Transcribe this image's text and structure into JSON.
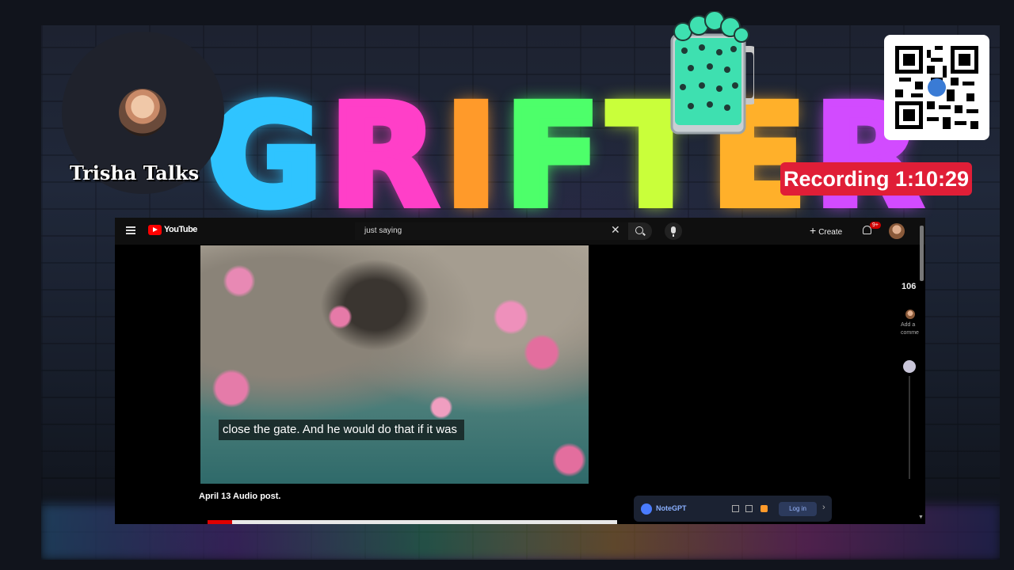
{
  "overlay": {
    "streamer_name": "Trisha Talks",
    "recording_label": "Recording 1:10:29"
  },
  "neon_sign": {
    "text": "GRIFTER"
  },
  "youtube": {
    "wordmark": "YouTube",
    "search_value": "just saying",
    "create_label": "Create",
    "notification_count": "9+",
    "view_count": "106",
    "add_comment": "Add a comme",
    "caption": "close the gate. And he would do that if it was",
    "video_title": "April 13 Audio post.",
    "progress_fraction": 0.06
  },
  "notegpt": {
    "label": "NoteGPT",
    "login_label": "Log in"
  },
  "colors": {
    "recording_red": "#e01e37",
    "youtube_red": "#ff0000",
    "neon_blue": "#2fc4ff",
    "neon_pink": "#ff3fc8",
    "neon_green": "#4dff6a",
    "neon_orange": "#ff9a2a",
    "neon_purple": "#d24bff"
  },
  "icons": [
    "menu-icon",
    "youtube-logo-icon",
    "clear-icon",
    "search-icon",
    "mic-icon",
    "plus-icon",
    "bell-icon",
    "notegpt-icon",
    "chevron-right-icon",
    "qr-code-icon",
    "beer-mug-icon"
  ]
}
